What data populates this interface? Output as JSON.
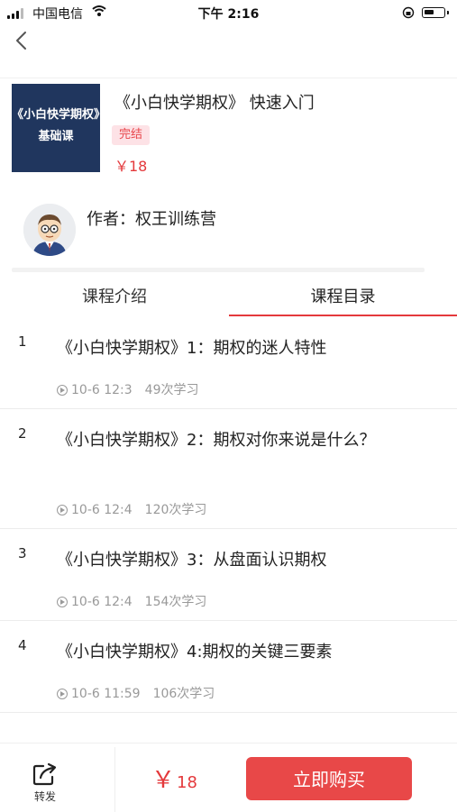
{
  "status_bar": {
    "carrier": "中国电信",
    "time": "下午 2:16",
    "battery_level": 0.55
  },
  "nav": {
    "back_icon": "chevron-left-icon"
  },
  "course": {
    "cover_line1": "《小白快学期权》",
    "cover_line2": "基础课",
    "title": "《小白快学期权》 快速入门",
    "status_badge": "完结",
    "price": "￥18",
    "author": "作者：权王训练营"
  },
  "tabs": [
    {
      "label": "课程介绍",
      "active": false
    },
    {
      "label": "课程目录",
      "active": true
    }
  ],
  "lessons": [
    {
      "index": "1",
      "title": "《小白快学期权》1：期权的迷人特性",
      "time": "10-6 12:3",
      "views": "49次学习"
    },
    {
      "index": "2",
      "title": "《小白快学期权》2：期权对你来说是什么？",
      "time": "10-6 12:4",
      "views": "120次学习"
    },
    {
      "index": "3",
      "title": "《小白快学期权》3：从盘面认识期权",
      "time": "10-6 12:4",
      "views": "154次学习"
    },
    {
      "index": "4",
      "title": "《小白快学期权》4:期权的关键三要素",
      "time": "10-6 11:59",
      "views": "106次学习"
    }
  ],
  "bottom_bar": {
    "share_label": "转发",
    "price_symbol": "￥",
    "price_amount": "18",
    "buy_label": "立即购买"
  },
  "colors": {
    "accent": "#e4393c",
    "buy_button": "#e84848",
    "cover_bg": "#20365e",
    "badge_bg": "#fde2e6"
  }
}
